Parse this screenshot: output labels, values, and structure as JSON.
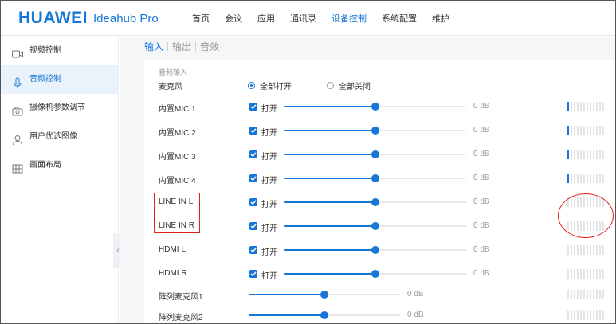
{
  "header": {
    "brand": "HUAWEI",
    "product": "Ideahub Pro",
    "nav": [
      {
        "label": "首页",
        "active": false
      },
      {
        "label": "会议",
        "active": false
      },
      {
        "label": "应用",
        "active": false
      },
      {
        "label": "通讯录",
        "active": false
      },
      {
        "label": "设备控制",
        "active": true
      },
      {
        "label": "系统配置",
        "active": false
      },
      {
        "label": "维护",
        "active": false
      }
    ]
  },
  "sidebar": {
    "items": [
      {
        "label": "视频控制",
        "icon": "video-camera-icon",
        "active": false
      },
      {
        "label": "音频控制",
        "icon": "microphone-icon",
        "active": true
      },
      {
        "label": "摄像机参数调节",
        "icon": "camera-settings-icon",
        "active": false
      },
      {
        "label": "用户优选图像",
        "icon": "user-icon",
        "active": false
      },
      {
        "label": "画面布局",
        "icon": "grid-layout-icon",
        "active": false
      }
    ],
    "collapse_glyph": "‹"
  },
  "tabs": [
    {
      "label": "输入",
      "active": true
    },
    {
      "label": "输出",
      "active": false
    },
    {
      "label": "音效",
      "active": false
    }
  ],
  "audio_input": {
    "section_title": "音频输入",
    "mic_label": "麦克风",
    "radio_all_on": "全部打开",
    "radio_all_off": "全部关闭",
    "selected": "all_on"
  },
  "channels": [
    {
      "name": "内置MIC 1",
      "checked": true,
      "check_label": "打开",
      "level_fraction": 0.5,
      "db": "0 dB",
      "meter_on": 1
    },
    {
      "name": "内置MIC 2",
      "checked": true,
      "check_label": "打开",
      "level_fraction": 0.5,
      "db": "0 dB",
      "meter_on": 1
    },
    {
      "name": "内置MIC 3",
      "checked": true,
      "check_label": "打开",
      "level_fraction": 0.5,
      "db": "0 dB",
      "meter_on": 1
    },
    {
      "name": "内置MIC 4",
      "checked": true,
      "check_label": "打开",
      "level_fraction": 0.5,
      "db": "0 dB",
      "meter_on": 1
    },
    {
      "name": "LINE IN L",
      "checked": true,
      "check_label": "打开",
      "level_fraction": 0.5,
      "db": "0 dB",
      "meter_on": 0
    },
    {
      "name": "LINE IN R",
      "checked": true,
      "check_label": "打开",
      "level_fraction": 0.5,
      "db": "0 dB",
      "meter_on": 0
    },
    {
      "name": "HDMI L",
      "checked": true,
      "check_label": "打开",
      "level_fraction": 0.5,
      "db": "0 dB",
      "meter_on": 0
    },
    {
      "name": "HDMI R",
      "checked": true,
      "check_label": "打开",
      "level_fraction": 0.5,
      "db": "0 dB",
      "meter_on": 0
    }
  ],
  "array_mics": [
    {
      "name": "阵列麦克风1",
      "level_fraction": 0.5,
      "db": "0 dB",
      "meter_on": 0
    },
    {
      "name": "阵列麦克风2",
      "level_fraction": 0.5,
      "db": "0 dB",
      "meter_on": 0
    }
  ],
  "colors": {
    "accent": "#1677d6",
    "highlight": "#e21f1f"
  }
}
